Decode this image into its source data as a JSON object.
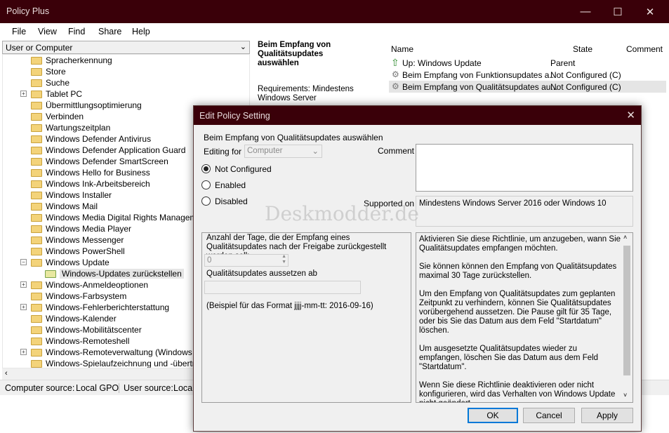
{
  "window": {
    "title": "Policy Plus",
    "min": "—",
    "max": "☐",
    "close": "✕"
  },
  "menu": [
    "File",
    "View",
    "Find",
    "Share",
    "Help"
  ],
  "combo": {
    "value": "User or Computer"
  },
  "tree": {
    "items": [
      {
        "label": "Spracherkennung"
      },
      {
        "label": "Store"
      },
      {
        "label": "Suche"
      },
      {
        "label": "Tablet PC"
      },
      {
        "label": "Übermittlungsoptimierung"
      },
      {
        "label": "Verbinden"
      },
      {
        "label": "Wartungszeitplan"
      },
      {
        "label": "Windows Defender Antivirus"
      },
      {
        "label": "Windows Defender Application Guard"
      },
      {
        "label": "Windows Defender SmartScreen"
      },
      {
        "label": "Windows Hello for Business"
      },
      {
        "label": "Windows Ink-Arbeitsbereich"
      },
      {
        "label": "Windows Installer"
      },
      {
        "label": "Windows Mail"
      },
      {
        "label": "Windows Media Digital Rights Management ("
      },
      {
        "label": "Windows Media Player"
      },
      {
        "label": "Windows Messenger"
      },
      {
        "label": "Windows PowerShell"
      },
      {
        "label": "Windows Update"
      },
      {
        "label": "Windows-Updates zurückstellen"
      },
      {
        "label": "Windows-Anmeldeoptionen"
      },
      {
        "label": "Windows-Farbsystem"
      },
      {
        "label": "Windows-Fehlerberichterstattung"
      },
      {
        "label": "Windows-Kalender"
      },
      {
        "label": "Windows-Mobilitätscenter"
      },
      {
        "label": "Windows-Remoteshell"
      },
      {
        "label": "Windows-Remoteverwaltung (Windows Rem"
      },
      {
        "label": "Windows-Spielaufzeichnung und -übertragun"
      }
    ]
  },
  "policy_panel": {
    "title": "Beim Empfang von Qualitätsupdates auswählen",
    "requirements": "Requirements: Mindestens Windows Server"
  },
  "list": {
    "headers": {
      "name": "Name",
      "state": "State",
      "comment": "Comment"
    },
    "rows": [
      {
        "name": "Up: Windows Update",
        "state": "Parent"
      },
      {
        "name": "Beim Empfang von Funktionsupdates a...",
        "state": "Not Configured (C)"
      },
      {
        "name": "Beim Empfang von Qualitätsupdates au...",
        "state": "Not Configured (C)"
      }
    ]
  },
  "status": {
    "computer_source_label": "Computer source:",
    "computer_source_value": "Local GPO",
    "user_source_label": "User source:",
    "user_source_value": "Local"
  },
  "dialog": {
    "title": "Edit Policy Setting",
    "setting_name": "Beim Empfang von Qualitätsupdates auswählen",
    "editing_for_label": "Editing for",
    "editing_for_value": "Computer",
    "comment_label": "Comment",
    "radios": {
      "not_configured": "Not Configured",
      "enabled": "Enabled",
      "disabled": "Disabled"
    },
    "selected": "not_configured",
    "supported_on_label": "Supported on",
    "supported_on_value": "Mindestens Windows Server 2016 oder Windows 10",
    "watermark": "Deskmodder.de",
    "options": {
      "days_label": "Anzahl der Tage, die der Empfang eines Qualitätsupdates nach der Freigabe zurückgestellt werden soll:",
      "days_value": "0",
      "pause_label": "Qualitätsupdates aussetzen ab",
      "pause_value": "",
      "format_hint": "(Beispiel für das Format jjjj-mm-tt: 2016-09-16)"
    },
    "help_paragraphs": [
      "Aktivieren Sie diese Richtlinie, um anzugeben, wann Sie Qualitätsupdates empfangen möchten.",
      "Sie können können den Empfang von Qualitätsupdates maximal 30 Tage zurückstellen.",
      "Um den Empfang von Qualitätsupdates zum geplanten Zeitpunkt zu verhindern, können Sie Qualitätsupdates vorübergehend aussetzen. Die Pause gilt für 35 Tage, oder bis Sie das Datum aus dem Feld \"Startdatum\" löschen.",
      "Um ausgesetzte Qualitätsupdates wieder zu empfangen, löschen Sie das Datum aus dem Feld \"Startdatum\".",
      "Wenn Sie diese Richtlinie deaktivieren oder nicht konfigurieren, wird das Verhalten von Windows Update nicht geändert."
    ],
    "buttons": {
      "ok": "OK",
      "cancel": "Cancel",
      "apply": "Apply"
    }
  }
}
